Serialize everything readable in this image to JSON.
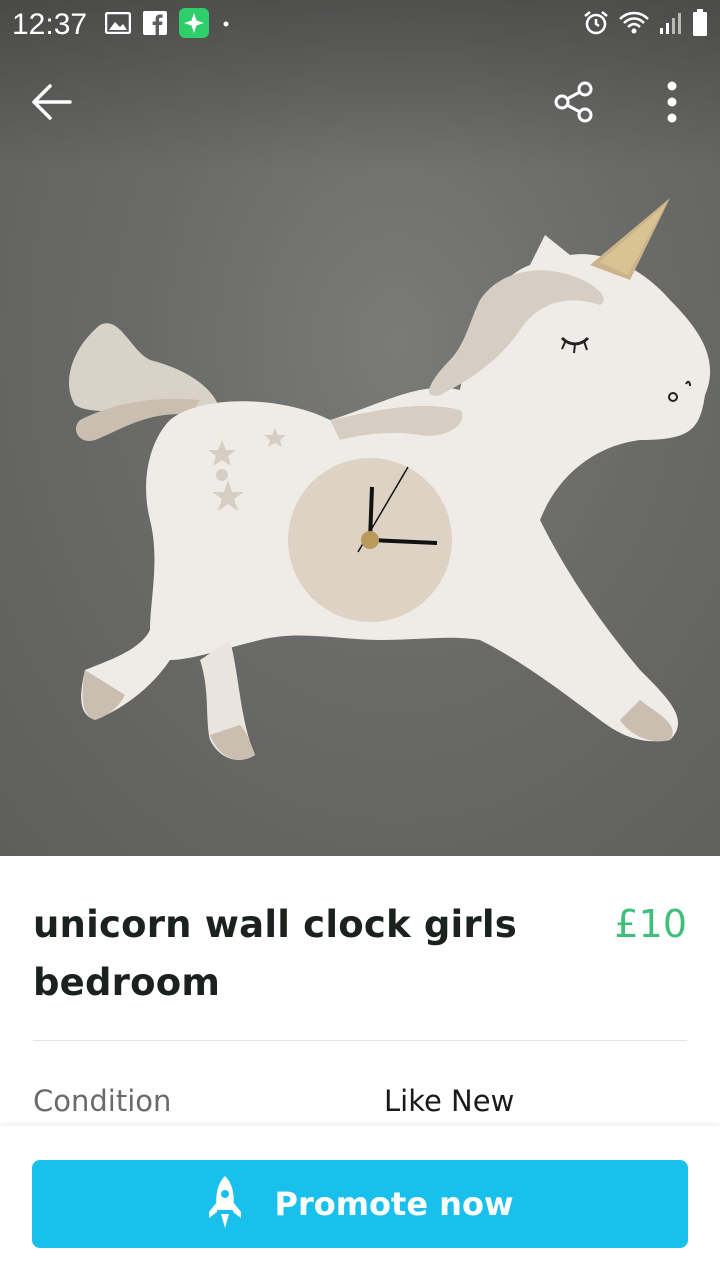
{
  "status_bar": {
    "time": "12:37",
    "left_icons": [
      "image-icon",
      "facebook-icon",
      "sparkle-app-icon",
      "dot-icon"
    ],
    "right_icons": [
      "alarm-icon",
      "wifi-icon",
      "signal-icon",
      "battery-icon"
    ]
  },
  "app_bar": {
    "icons": [
      "back-arrow-icon",
      "share-icon",
      "more-vert-icon"
    ]
  },
  "listing": {
    "title": "unicorn wall clock girls bedroom",
    "price": "£10",
    "condition_label": "Condition",
    "condition_value": "Like New"
  },
  "bottom_bar": {
    "promote_label": "Promote now",
    "promote_icon": "rocket-icon"
  },
  "colors": {
    "price": "#3fbf7a",
    "promote_button": "#1ac0ec",
    "title": "#1b211d"
  }
}
